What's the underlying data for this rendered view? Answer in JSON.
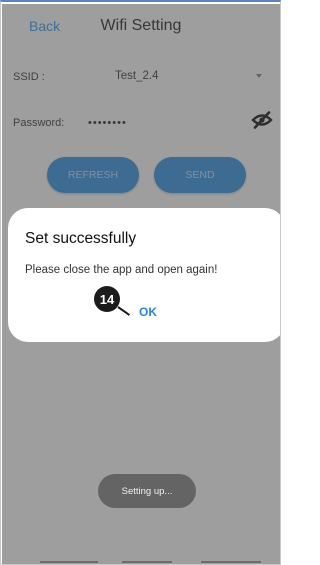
{
  "header": {
    "back_label": "Back",
    "title": "Wifi Setting"
  },
  "form": {
    "ssid_label": "SSID :",
    "ssid_value": "Test_2.4",
    "password_label": "Password:",
    "password_value": "••••••••"
  },
  "buttons": {
    "refresh_label": "REFRESH",
    "send_label": "SEND"
  },
  "dialog": {
    "title": "Set successfully",
    "message": "Please close the app and open again!",
    "ok_label": "OK",
    "step_number": "14"
  },
  "toast": {
    "text": "Setting up..."
  },
  "icons": {
    "dropdown": "chevron-down-icon",
    "password_toggle": "eye-off-icon"
  },
  "colors": {
    "accent": "#2f84cf",
    "link": "#2f8fd8"
  }
}
